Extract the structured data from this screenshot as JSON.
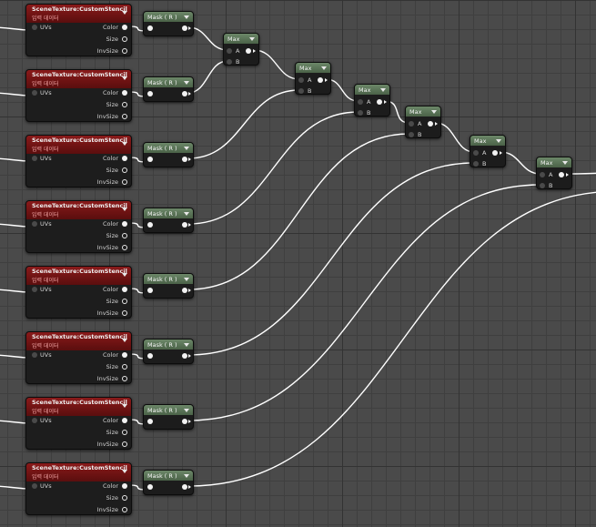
{
  "scene_texture": {
    "title": "SceneTexture:CustomStencil",
    "subtitle": "입력 데이터",
    "input_uvs": "UVs",
    "outputs": [
      "Color",
      "Size",
      "InvSize"
    ]
  },
  "mask": {
    "title": "Mask ( R )"
  },
  "max": {
    "title": "Max",
    "input_a": "A",
    "input_b": "B"
  },
  "node_count": {
    "scene_texture": 8,
    "mask": 8,
    "max": 6
  },
  "colors": {
    "canvas": "#4a4a4a",
    "scene_texture_header": "#7a1414",
    "math_header": "#5d7759",
    "wire": "#ffffff"
  }
}
